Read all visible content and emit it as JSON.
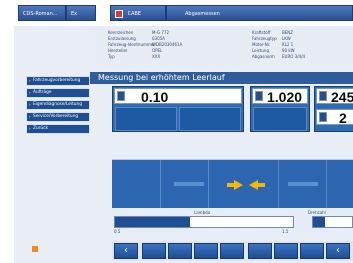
{
  "topbar": {
    "item1": "CDS-Roman... ",
    "item2": "Ex",
    "item3": "CABE",
    "item4": "Abgasmessen"
  },
  "info": {
    "left_labels": [
      "Kennzeichen",
      "Erstzulassung",
      "Fahrzeug-Identnummer",
      "Hersteller",
      "Typ"
    ],
    "left_values": [
      "M-G 772",
      "0305A",
      "WDB2030461A",
      "OPEL",
      "XXX"
    ],
    "right_labels": [
      "Kraftstoff",
      "Fahrzeugtyp",
      "Motor-Nr.",
      "Leistung",
      "Abgasnorm"
    ],
    "right_values": [
      "BENZ",
      "LKW",
      "KL2 1",
      "90 kW",
      "EURO 3/4/4"
    ]
  },
  "title": "Messung bei erhöhtem Leerlauf",
  "sidebar": {
    "items": [
      "Fahrzeugvorbereitung",
      "Aufträge",
      "Eigendiagnose/Leitung",
      "Service/Vorbereitung",
      "Zurück"
    ]
  },
  "meters": {
    "m1_value": "0.10",
    "m2_value": "1.020",
    "m3_value": "245",
    "m4_value": "2"
  },
  "bars": {
    "left_label": "Lambda",
    "right_label": "Drehzahl",
    "left_min": "0.5",
    "left_max": "1.5",
    "left_level": 0.42
  },
  "colors": {
    "accent": "#2f5d9c",
    "arrow": "#f5b700",
    "orange": "#f28a1e"
  },
  "bottombar": {
    "back_icon": "‹",
    "prev_icon": "‹"
  }
}
